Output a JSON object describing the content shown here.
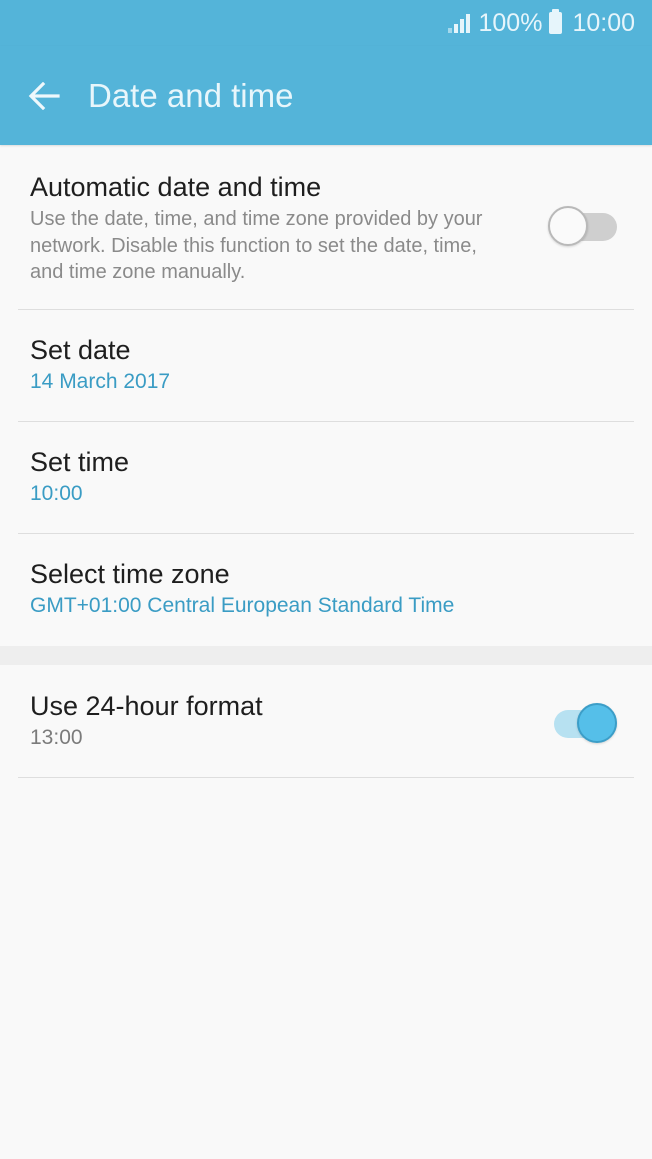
{
  "status_bar": {
    "battery_percent": "100%",
    "time": "10:00",
    "signal_icon": "signal-icon",
    "battery_icon": "battery-icon"
  },
  "app_bar": {
    "back_icon": "back-arrow-icon",
    "title": "Date and time",
    "color": "#54b4d9"
  },
  "settings": {
    "automatic": {
      "title": "Automatic date and time",
      "description": "Use the date, time, and time zone provided by your network. Disable this function to set the date, time, and time zone manually.",
      "enabled": false
    },
    "set_date": {
      "title": "Set date",
      "value": "14 March 2017"
    },
    "set_time": {
      "title": "Set time",
      "value": "10:00"
    },
    "time_zone": {
      "title": "Select time zone",
      "value": "GMT+01:00 Central European Standard Time"
    },
    "format_24h": {
      "title": "Use 24-hour format",
      "value": "13:00",
      "enabled": true
    }
  },
  "colors": {
    "accent": "#3a9cc4",
    "toggle_on": "#55bfe9",
    "toggle_off": "#cfcfcf"
  }
}
